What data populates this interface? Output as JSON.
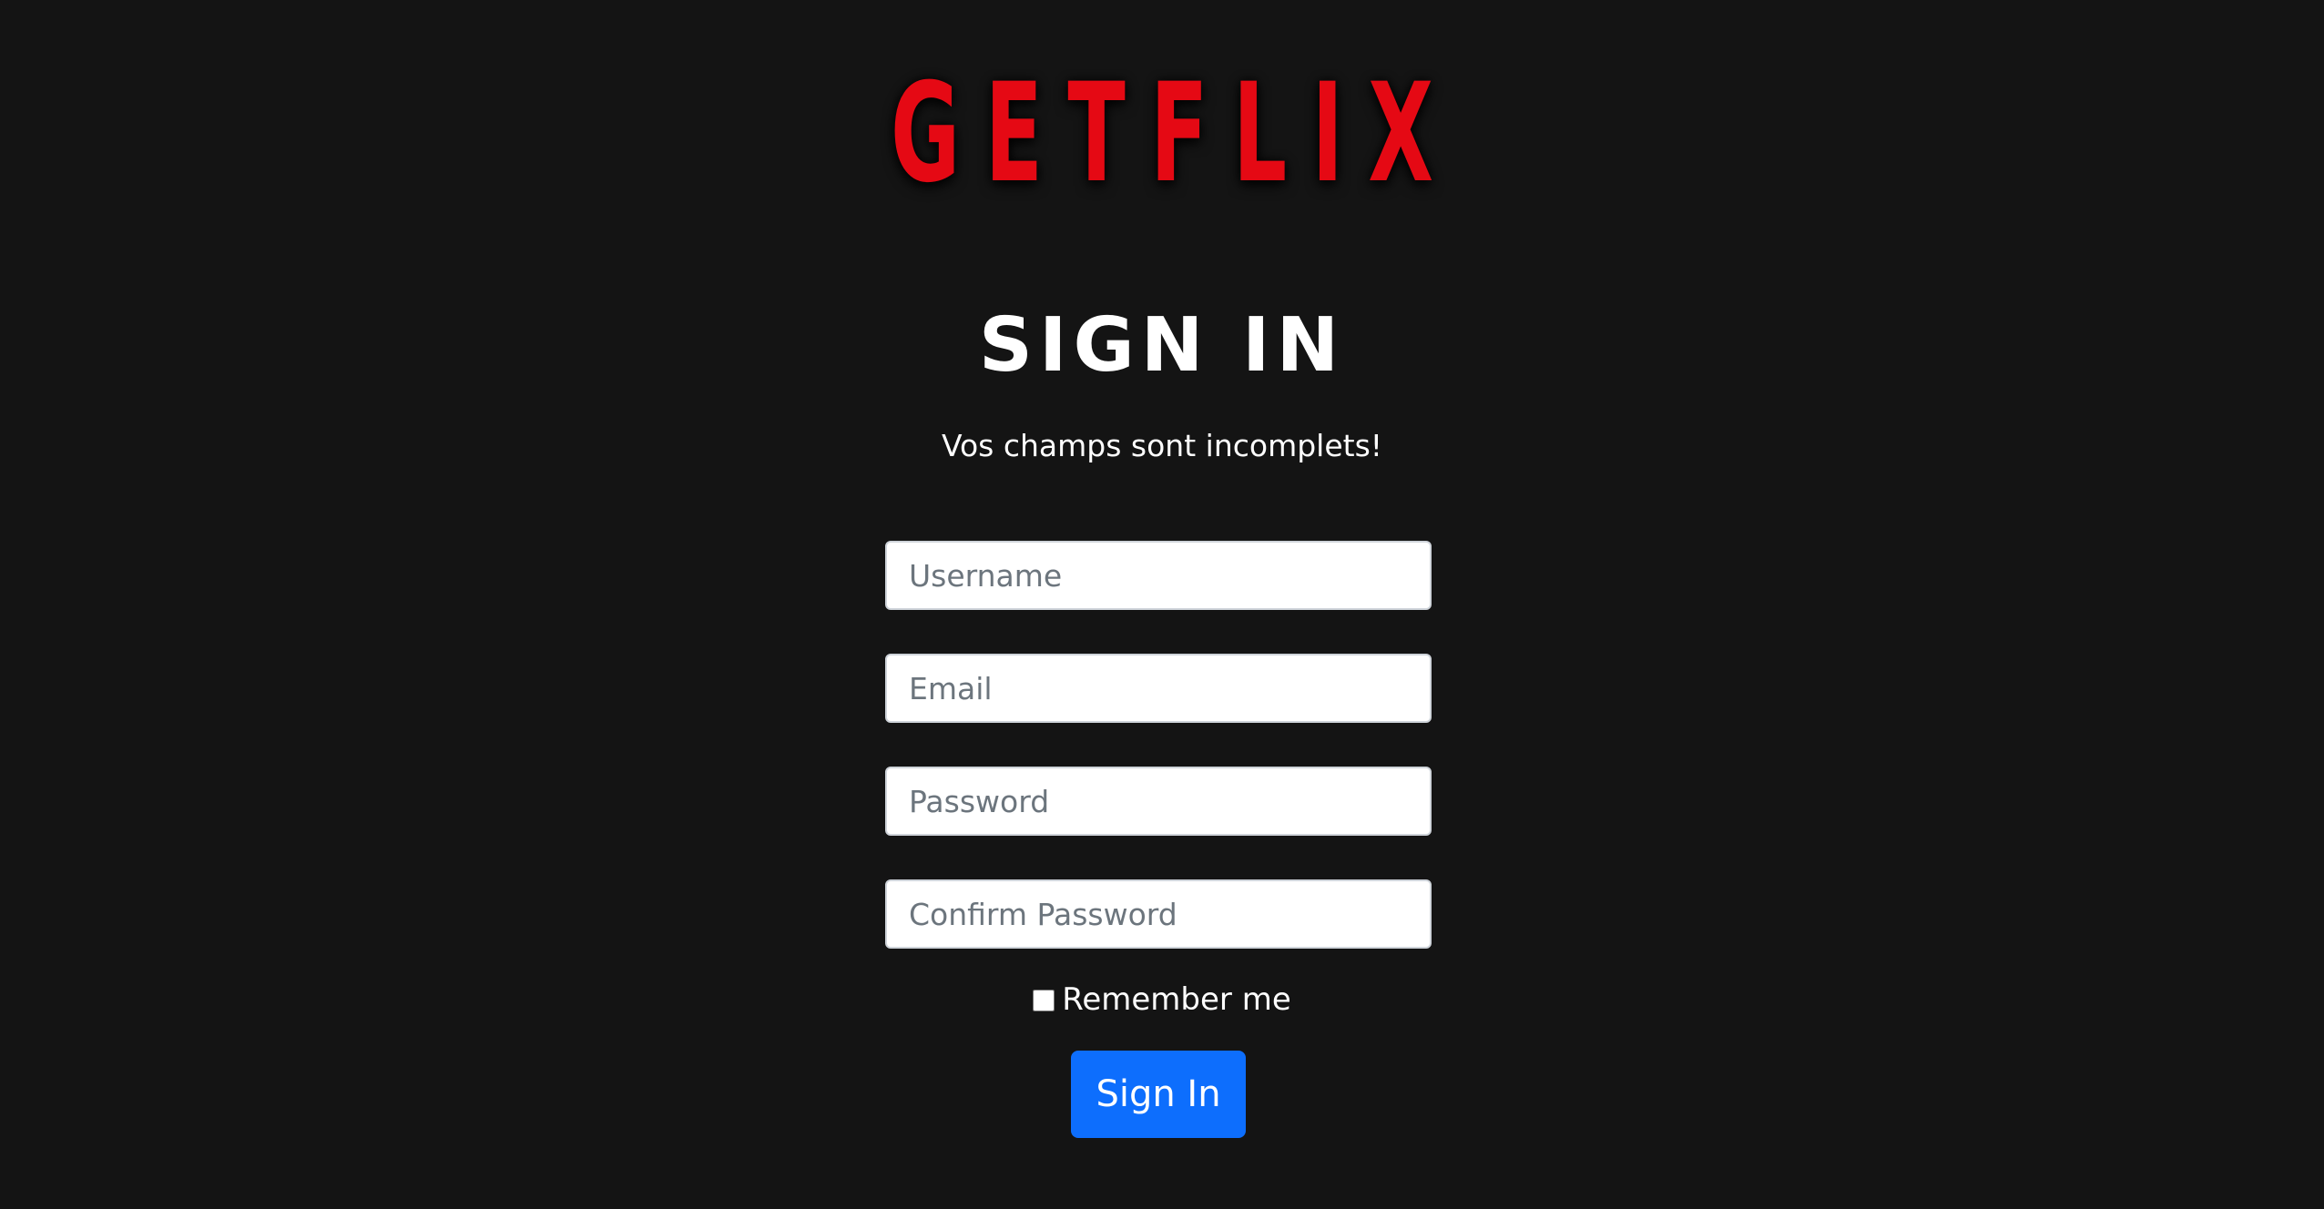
{
  "brand": {
    "logo_text": "GETFLIX",
    "logo_color": "#e50914"
  },
  "form": {
    "title": "SIGN IN",
    "message": "Vos champs sont incomplets!",
    "fields": {
      "username_placeholder": "Username",
      "email_placeholder": "Email",
      "password_placeholder": "Password",
      "confirm_password_placeholder": "Confirm Password"
    },
    "remember_label": "Remember me",
    "remember_checked": false,
    "submit_label": "Sign In",
    "submit_color": "#0d6efd"
  },
  "theme": {
    "background": "#141414",
    "text": "#ffffff"
  }
}
